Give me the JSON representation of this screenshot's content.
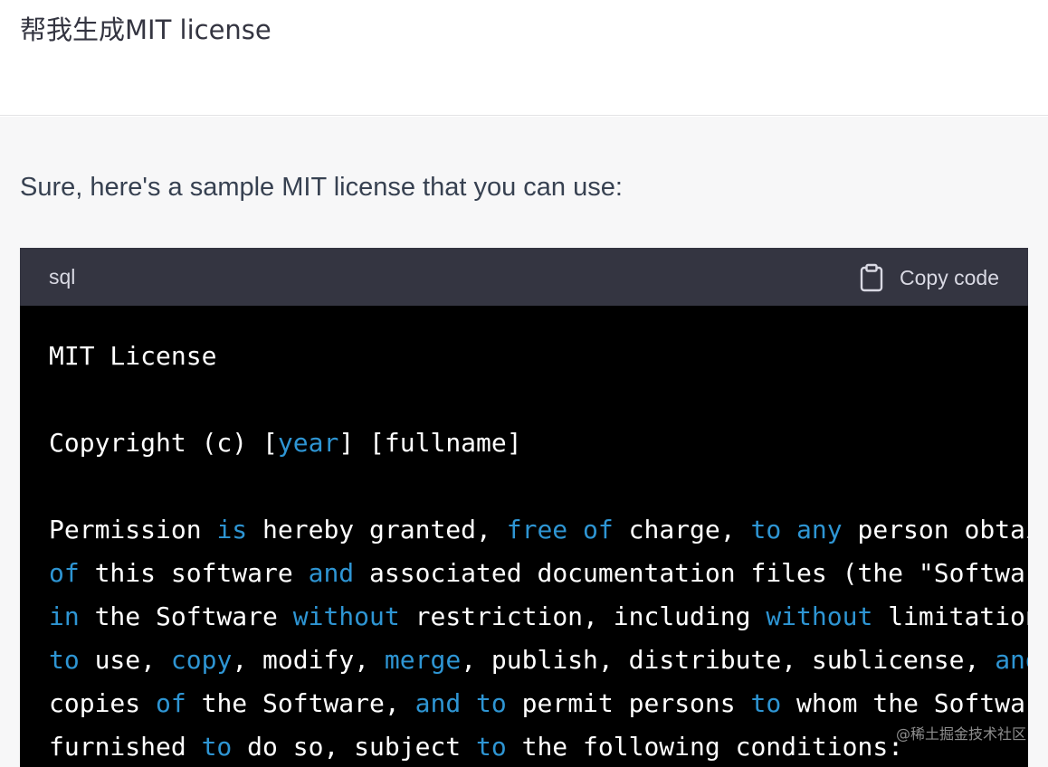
{
  "user_message": {
    "text": "帮我生成MIT license"
  },
  "assistant_message": {
    "intro": "Sure, here's a sample MIT license that you can use:",
    "code_block": {
      "language": "sql",
      "copy_label": "Copy code",
      "copy_icon": "clipboard-icon",
      "keyword_color": "#2e95d3",
      "lines": [
        [
          {
            "t": "MIT License"
          }
        ],
        [
          {
            "t": ""
          }
        ],
        [
          {
            "t": "Copyright (c) ["
          },
          {
            "t": "year",
            "k": true
          },
          {
            "t": "] [fullname]"
          }
        ],
        [
          {
            "t": ""
          }
        ],
        [
          {
            "t": "Permission "
          },
          {
            "t": "is",
            "k": true
          },
          {
            "t": " hereby granted, "
          },
          {
            "t": "free",
            "k": true
          },
          {
            "t": " "
          },
          {
            "t": "of",
            "k": true
          },
          {
            "t": " charge, "
          },
          {
            "t": "to",
            "k": true
          },
          {
            "t": " "
          },
          {
            "t": "any",
            "k": true
          },
          {
            "t": " person obtai"
          }
        ],
        [
          {
            "t": "of",
            "k": true
          },
          {
            "t": " this software "
          },
          {
            "t": "and",
            "k": true
          },
          {
            "t": " associated documentation files (the \"Softwar"
          }
        ],
        [
          {
            "t": "in",
            "k": true
          },
          {
            "t": " the Software "
          },
          {
            "t": "without",
            "k": true
          },
          {
            "t": " restriction, including "
          },
          {
            "t": "without",
            "k": true
          },
          {
            "t": " limitation"
          }
        ],
        [
          {
            "t": "to",
            "k": true
          },
          {
            "t": " use, "
          },
          {
            "t": "copy",
            "k": true
          },
          {
            "t": ", modify, "
          },
          {
            "t": "merge",
            "k": true
          },
          {
            "t": ", publish, distribute, sublicense, "
          },
          {
            "t": "and",
            "k": true
          }
        ],
        [
          {
            "t": "copies "
          },
          {
            "t": "of",
            "k": true
          },
          {
            "t": " the Software, "
          },
          {
            "t": "and",
            "k": true
          },
          {
            "t": " "
          },
          {
            "t": "to",
            "k": true
          },
          {
            "t": " permit persons "
          },
          {
            "t": "to",
            "k": true
          },
          {
            "t": " whom the Softwar"
          }
        ],
        [
          {
            "t": "furnished "
          },
          {
            "t": "to",
            "k": true
          },
          {
            "t": " do so, subject "
          },
          {
            "t": "to",
            "k": true
          },
          {
            "t": " the following conditions:"
          }
        ]
      ]
    }
  },
  "watermark": "@稀土掘金技术社区"
}
